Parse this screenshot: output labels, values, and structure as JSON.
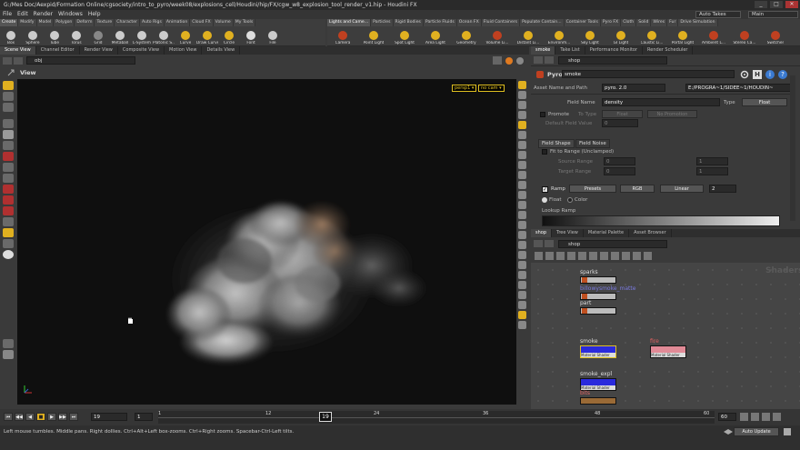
{
  "window": {
    "title": "G:/Mes Doc/Aexpid/Formation Online/cgsociety/intro_to_pyro/week08/explosions_cell/Houdini/hip/FX/cgw_w8_explosion_tool_render_v1.hip - Houdini FX",
    "min": "_",
    "max": "□",
    "close": "✕"
  },
  "menu": [
    "File",
    "Edit",
    "Render",
    "Windows",
    "Help"
  ],
  "desktop": {
    "auto_takes": "Auto Takes",
    "main": "Main"
  },
  "shelf_left": {
    "tabs": [
      "Create",
      "Modify",
      "Model",
      "Polygon",
      "Deform",
      "Texture",
      "Character",
      "Auto Rigs",
      "Animation",
      "Cloud FX",
      "Volume",
      "My Tools"
    ],
    "tools": [
      "Box",
      "Sphere",
      "Tube",
      "Torus",
      "Grid",
      "Metaball",
      "L-System",
      "Platonic S...",
      "Curve",
      "Draw Curve",
      "Circle",
      "Font",
      "File"
    ]
  },
  "shelf_right": {
    "tabs": [
      "Lights and Came...",
      "Particles",
      "Rigid Bodies",
      "Particle Fluids",
      "Ocean FX",
      "Fluid Containers",
      "Populate Contain...",
      "Container Tools",
      "Pyro FX",
      "Cloth",
      "Solid",
      "Wires",
      "Fur",
      "Drive Simulation"
    ],
    "tools": [
      "Camera",
      "Point Light",
      "Spot Light",
      "Area Light",
      "Geometry",
      "Volume Li...",
      "Distant Li...",
      "Environm...",
      "Sky Light",
      "GI Light",
      "Caustic Li...",
      "Portal Light",
      "Ambient L...",
      "Stereo Ca...",
      "Switcher"
    ]
  },
  "left_pane_tabs": [
    "Scene View",
    "Channel Editor",
    "Render View",
    "Composite View",
    "Motion View",
    "Details View"
  ],
  "right_pane_tabs": [
    "smoke",
    "Take List",
    "Performance Monitor",
    "Render Scheduler"
  ],
  "viewport": {
    "path": "obj",
    "label": "View",
    "persp": "persp1 ▾",
    "cam": "no cam ▾"
  },
  "params": {
    "node_type": "Pyro",
    "node_name": "smoke",
    "asset_label": "Asset Name and Path",
    "asset_name": "pyro. 2.0",
    "asset_path": "E:/PROGRA~1/SIDEE~1/HOUDIN~",
    "field_name_label": "Field Name",
    "field_name": "density",
    "type_label": "Type",
    "type_value": "Float",
    "promote_label": "Promote",
    "to_type_label": "To Type",
    "to_type_value": "Float",
    "no_promotion": "No Promotion",
    "default_field_label": "Default Field Value",
    "default_field_value": "0",
    "tab_field_shape": "Field Shape",
    "tab_field_noise": "Field Noise",
    "fit_range": "Fit to Range (Unclamped)",
    "source_range": "Source Range",
    "target_range": "Target Range",
    "sr0": "0",
    "sr1": "1",
    "tr0": "0",
    "tr1": "1",
    "ramp_label": "Ramp",
    "presets": "Presets",
    "rgb": "RGB",
    "linear": "Linear",
    "ramp_count": "2",
    "float_label": "Float",
    "color_label": "Color",
    "lookup_ramp": "Lookup Ramp"
  },
  "network": {
    "tabs": [
      "shop",
      "Tree View",
      "Material Palette",
      "Asset Browser"
    ],
    "path": "shop",
    "context_label": "Shaders",
    "nodes": [
      {
        "name": "sparks",
        "color": "#bcbcbc"
      },
      {
        "name": "billowysmoke_matte",
        "color": "#bcbcbc"
      },
      {
        "name": "part",
        "color": "#bcbcbc"
      },
      {
        "name": "smoke",
        "color": "#2a2adc",
        "sub": "Material Shader"
      },
      {
        "name": "fire",
        "color": "#e08a96",
        "sub": "Material Shader"
      },
      {
        "name": "smoke_expl",
        "color": "#2a2adc",
        "sub": "Material Shader"
      },
      {
        "name": "bits",
        "color": "#9a6a36"
      }
    ]
  },
  "timeline": {
    "frame": "19",
    "step": "1",
    "current_frame": "19",
    "end": "60",
    "ticks": [
      "1",
      "12",
      "24",
      "36",
      "48",
      "60"
    ],
    "auto_update": "Auto Update"
  },
  "status": "Left mouse tumbles. Middle pans. Right dollies. Ctrl+Alt+Left box-zooms. Ctrl+Right zooms. Spacebar-Ctrl-Left tilts."
}
